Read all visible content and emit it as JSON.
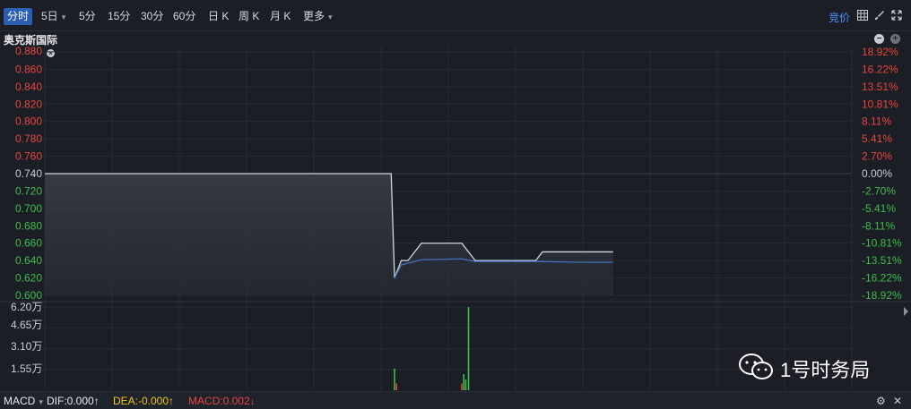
{
  "toolbar": {
    "tabs": [
      "分时",
      "5日",
      "5分",
      "15分",
      "30分",
      "60分",
      "日 K",
      "周 K",
      "月 K",
      "更多"
    ],
    "auction_label": "竞价",
    "icons": [
      "grid-icon",
      "brush-icon",
      "expand-icon"
    ]
  },
  "stock": {
    "name": "奥克斯国际"
  },
  "price_axis": {
    "left": [
      "0.880",
      "0.860",
      "0.840",
      "0.820",
      "0.800",
      "0.780",
      "0.760",
      "0.740",
      "0.720",
      "0.700",
      "0.680",
      "0.660",
      "0.640",
      "0.620",
      "0.600"
    ],
    "right": [
      "18.92%",
      "16.22%",
      "13.51%",
      "10.81%",
      "8.11%",
      "5.41%",
      "2.70%",
      "0.00%",
      "-2.70%",
      "-5.41%",
      "-8.11%",
      "-10.81%",
      "-13.51%",
      "-16.22%",
      "-18.92%"
    ],
    "prev_close": "0.740"
  },
  "volume_axis": {
    "labels": [
      "6.20万",
      "4.65万",
      "3.10万",
      "1.55万"
    ]
  },
  "indicator": {
    "name": "MACD",
    "dif": "DIF:0.000↑",
    "dea": "DEA:-0.000↑",
    "macd": "MACD:0.002↓"
  },
  "watermark": {
    "text": "1号时务局"
  },
  "colors": {
    "up": "#e8453c",
    "down": "#3dbd4e",
    "neutral": "#c8ccd4",
    "accent": "#2b5fb3",
    "dea": "#f0c419"
  },
  "chart_data": {
    "type": "line",
    "title": "",
    "ylim": [
      0.6,
      0.88
    ],
    "prev_close": 0.74,
    "series": [
      {
        "x": [
          0,
          103,
          104,
          106,
          108,
          112,
          124,
          128,
          132,
          146,
          148,
          160,
          169
        ],
        "values": [
          0.74,
          0.74,
          0.62,
          0.64,
          0.64,
          0.66,
          0.66,
          0.64,
          0.64,
          0.64,
          0.65,
          0.65,
          0.65
        ]
      },
      {
        "x": [
          104,
          106,
          112,
          124,
          128,
          146,
          160,
          169
        ],
        "values": [
          0.62,
          0.635,
          0.641,
          0.642,
          0.639,
          0.639,
          0.638,
          0.638
        ]
      }
    ],
    "volume": {
      "ylim": [
        0,
        62000
      ],
      "bars": [
        {
          "x": 104,
          "value": 16000,
          "dir": "down"
        },
        {
          "x": 104.6,
          "value": 5000,
          "dir": "up"
        },
        {
          "x": 124,
          "value": 5000,
          "dir": "up"
        },
        {
          "x": 124.6,
          "value": 12000,
          "dir": "down"
        },
        {
          "x": 125.2,
          "value": 8000,
          "dir": "down"
        },
        {
          "x": 126,
          "value": 62000,
          "dir": "down"
        }
      ]
    }
  }
}
